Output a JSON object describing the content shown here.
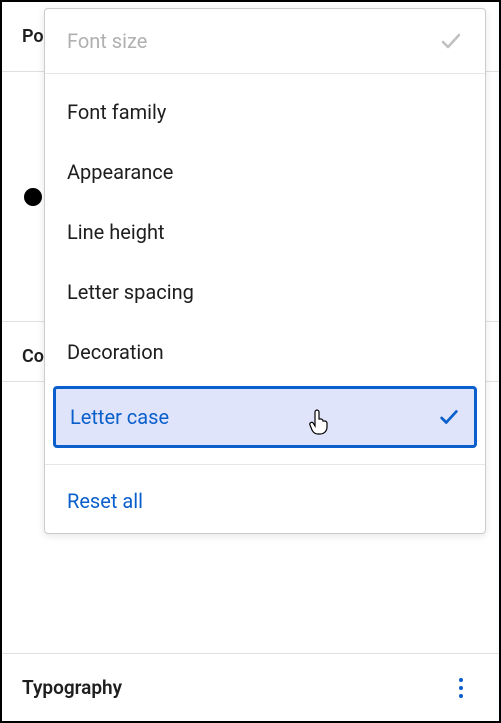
{
  "background": {
    "post_label": "Post",
    "color_label": "Color"
  },
  "dropdown": {
    "header": "Font size",
    "items": [
      "Font family",
      "Appearance",
      "Line height",
      "Letter spacing",
      "Decoration"
    ],
    "selected": "Letter case",
    "reset": "Reset all"
  },
  "typography": {
    "label": "Typography"
  }
}
